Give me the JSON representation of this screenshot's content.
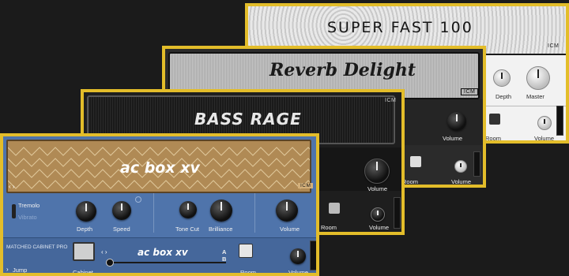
{
  "amps": {
    "superfast": {
      "title": "SUPER FAST 100",
      "badge": "ICM",
      "controls": {
        "depth": "Depth",
        "master": "Master"
      },
      "bottom": {
        "room": "Room",
        "volume": "Volume"
      }
    },
    "reverb": {
      "title": "Reverb Delight",
      "badge": "ICM",
      "controls": {
        "volume": "Volume"
      },
      "bottom": {
        "room": "Room",
        "volume": "Volume"
      }
    },
    "bass": {
      "title": "BASS RAGE",
      "badge": "ICM",
      "controls": {
        "volume": "Volume"
      },
      "bottom": {
        "room": "Room",
        "volume": "Volume"
      }
    },
    "acbox": {
      "title": "ac box xv",
      "badge": "ICM",
      "mode_options": [
        "Tremolo",
        "Vibrato"
      ],
      "controls": {
        "depth": "Depth",
        "speed": "Speed",
        "tone_cut": "Tone Cut",
        "brilliance": "Brilliance",
        "volume": "Volume"
      },
      "cabinet": {
        "product": "MATCHED CABINET PRO",
        "jump": "Jump",
        "cabinet_label": "Cabinet",
        "cabinet_name": "ac box xv",
        "mic_a": "A",
        "mic_b": "B",
        "room": "Room",
        "volume": "Volume"
      }
    }
  },
  "colors": {
    "frame": "#e3bd2a",
    "acbox_panel": "#4f74ab",
    "background": "#1b1b1b"
  }
}
